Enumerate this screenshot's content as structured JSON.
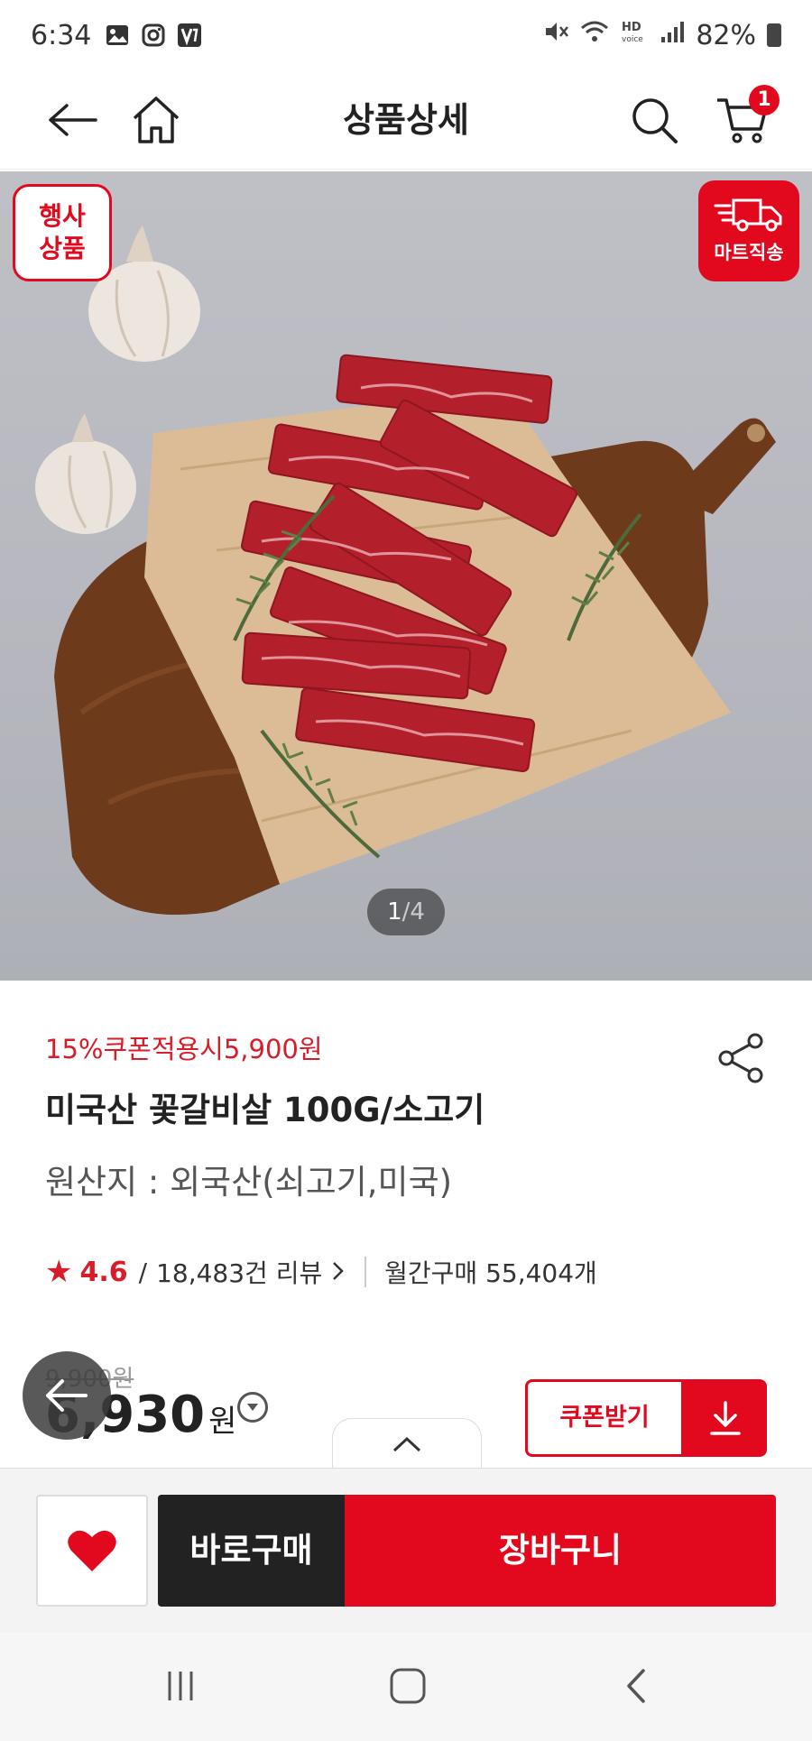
{
  "status_bar": {
    "time": "6:34",
    "battery": "82%"
  },
  "header": {
    "title": "상품상세",
    "cart_count": "1"
  },
  "hero": {
    "event_tag_line1": "행사",
    "event_tag_line2": "상품",
    "delivery_tag": "마트직송",
    "page_current": "1",
    "page_separator": "/",
    "page_total": "4"
  },
  "product": {
    "coupon_text": "15%쿠폰적용시5,900원",
    "name": "미국산 꽃갈비살 100G/소고기",
    "origin": "원산지 : 외국산(쇠고기,미국)",
    "rating": "4.6",
    "rating_separator": "/",
    "review_count": "18,483건 리뷰",
    "monthly_sales": "월간구매 55,404개",
    "original_price": "9,900원",
    "price": "6,930",
    "price_unit": "원",
    "coupon_button": "쿠폰받기"
  },
  "actions": {
    "buy_now": "바로구매",
    "add_to_cart": "장바구니"
  },
  "colors": {
    "accent": "#e2081d",
    "dark": "#222222"
  }
}
